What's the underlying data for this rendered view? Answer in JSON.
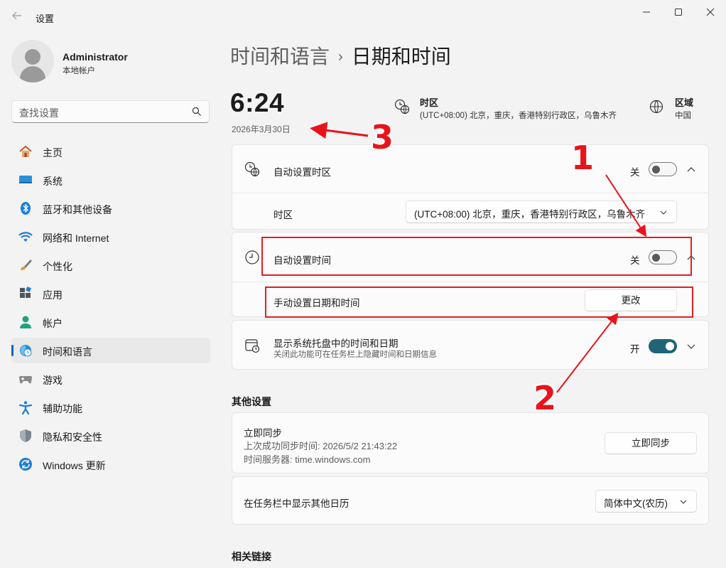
{
  "window": {
    "title": "设置"
  },
  "profile": {
    "name": "Administrator",
    "account_type": "本地帐户"
  },
  "search": {
    "placeholder": "查找设置"
  },
  "nav": {
    "items": [
      {
        "label": "主页",
        "icon": "home-icon"
      },
      {
        "label": "系统",
        "icon": "system-icon"
      },
      {
        "label": "蓝牙和其他设备",
        "icon": "bluetooth-icon"
      },
      {
        "label": "网络和 Internet",
        "icon": "wifi-icon"
      },
      {
        "label": "个性化",
        "icon": "brush-icon"
      },
      {
        "label": "应用",
        "icon": "apps-icon"
      },
      {
        "label": "帐户",
        "icon": "account-icon"
      },
      {
        "label": "时间和语言",
        "icon": "time-language-icon",
        "active": true
      },
      {
        "label": "游戏",
        "icon": "gamepad-icon"
      },
      {
        "label": "辅助功能",
        "icon": "accessibility-icon"
      },
      {
        "label": "隐私和安全性",
        "icon": "shield-icon"
      },
      {
        "label": "Windows 更新",
        "icon": "update-icon"
      }
    ]
  },
  "breadcrumb": {
    "parent": "时间和语言",
    "separator": "›",
    "current": "日期和时间"
  },
  "clock": {
    "time": "6:24",
    "date": "2026年3月30日"
  },
  "summary": {
    "timezone_title": "时区",
    "timezone_value": "(UTC+08:00) 北京，重庆，香港特别行政区，乌鲁木齐",
    "region_title": "区域",
    "region_value": "中国"
  },
  "settings": {
    "auto_timezone": {
      "label": "自动设置时区",
      "state": "关",
      "on": false
    },
    "timezone_row": {
      "label": "时区",
      "value": "(UTC+08:00) 北京，重庆，香港特别行政区，乌鲁木齐"
    },
    "auto_time": {
      "label": "自动设置时间",
      "state": "关",
      "on": false
    },
    "manual_time": {
      "label": "手动设置日期和时间",
      "button": "更改"
    },
    "tray_time": {
      "label": "显示系统托盘中的时间和日期",
      "sublabel": "关闭此功能可在任务栏上隐藏时间和日期信息",
      "state": "开",
      "on": true
    }
  },
  "other_settings": {
    "heading": "其他设置",
    "sync": {
      "label": "立即同步",
      "last_sync": "上次成功同步时间: 2026/5/2 21:43:22",
      "server": "时间服务器: time.windows.com",
      "button": "立即同步"
    },
    "calendar": {
      "label": "在任务栏中显示其他日历",
      "value": "简体中文(农历)"
    }
  },
  "related": {
    "heading": "相关链接"
  },
  "annotations": {
    "n1": "1",
    "n2": "2",
    "n3": "3",
    "color": "#e8141c"
  },
  "colors": {
    "accent": "#0067c0",
    "toggle_on": "#1f6577",
    "annotation_red": "#e02020"
  }
}
